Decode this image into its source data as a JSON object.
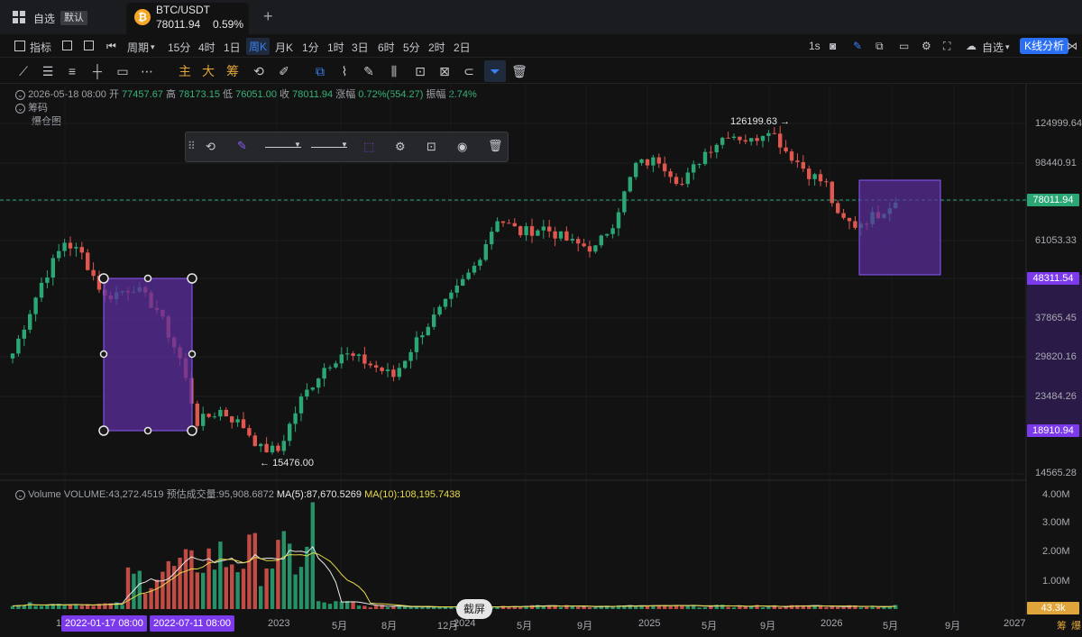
{
  "tabbar": {
    "watchlist": "自选",
    "default_badge": "默认",
    "pair": "BTC/USDT",
    "price": "78011.94",
    "change": "0.59%",
    "add": "+"
  },
  "toolbar": {
    "indicators": "指标",
    "period": "周期",
    "timeframes": [
      "15分",
      "4时",
      "1日",
      "周K",
      "月K",
      "1分",
      "1时",
      "3日",
      "6时",
      "5分",
      "2时",
      "2日"
    ],
    "active_timeframe": "周K",
    "interval_1s": "1s",
    "watch_label": "自选",
    "kline_analysis": "K线分析",
    "draw_text": {
      "main": "主",
      "big": "大",
      "chips": "筹"
    }
  },
  "ohlc": {
    "date": "2026-05-18 08:00",
    "open_label": "开",
    "open": "77457.67",
    "high_label": "高",
    "high": "78173.15",
    "low_label": "低",
    "low": "76051.00",
    "close_label": "收",
    "close": "78011.94",
    "chg_label": "涨幅",
    "chg": "0.72%(554.27)",
    "amp_label": "振幅",
    "amp": "2.74%"
  },
  "overlays": {
    "chips": "筹码",
    "liq": "爆仓图"
  },
  "chart_data": {
    "type": "candlestick",
    "symbol": "BTC/USDT",
    "interval": "weekly",
    "y_scale": "log",
    "ylim": [
      14000,
      150000
    ],
    "price_ticks": [
      "124999.64",
      "98440.91",
      "61053.33",
      "37865.45",
      "29820.16",
      "23484.26",
      "14565.28"
    ],
    "current_price": "78011.94",
    "range_labels": [
      "48311.54",
      "18910.94"
    ],
    "high_annotation": "126199.63",
    "low_annotation": "15476.00",
    "x_ticks": [
      "1",
      "2023",
      "5月",
      "8月",
      "12月",
      "2024",
      "5月",
      "9月",
      "2025",
      "5月",
      "9月",
      "2026",
      "5月",
      "9月",
      "2027"
    ],
    "x_selected": [
      "2022-01-17 08:00",
      "2022-07-11 08:00"
    ],
    "price_anchors": [
      {
        "t": 0,
        "p": 30500
      },
      {
        "t": 5,
        "p": 47000
      },
      {
        "t": 9,
        "p": 60500
      },
      {
        "t": 12,
        "p": 56000
      },
      {
        "t": 16,
        "p": 43000
      },
      {
        "t": 21,
        "p": 46000
      },
      {
        "t": 25,
        "p": 40000
      },
      {
        "t": 29,
        "p": 29500
      },
      {
        "t": 32,
        "p": 20000
      },
      {
        "t": 36,
        "p": 21500
      },
      {
        "t": 40,
        "p": 19500
      },
      {
        "t": 43,
        "p": 17000
      },
      {
        "t": 46,
        "p": 16800
      },
      {
        "t": 50,
        "p": 23000
      },
      {
        "t": 54,
        "p": 28000
      },
      {
        "t": 57,
        "p": 30500
      },
      {
        "t": 61,
        "p": 29000
      },
      {
        "t": 66,
        "p": 26500
      },
      {
        "t": 71,
        "p": 35000
      },
      {
        "t": 76,
        "p": 43000
      },
      {
        "t": 80,
        "p": 52000
      },
      {
        "t": 84,
        "p": 70000
      },
      {
        "t": 88,
        "p": 64000
      },
      {
        "t": 92,
        "p": 66000
      },
      {
        "t": 97,
        "p": 60000
      },
      {
        "t": 101,
        "p": 58000
      },
      {
        "t": 104,
        "p": 68000
      },
      {
        "t": 108,
        "p": 97000
      },
      {
        "t": 112,
        "p": 100000
      },
      {
        "t": 116,
        "p": 86000
      },
      {
        "t": 120,
        "p": 105000
      },
      {
        "t": 124,
        "p": 118000
      },
      {
        "t": 128,
        "p": 112000
      },
      {
        "t": 131,
        "p": 122000
      },
      {
        "t": 134,
        "p": 106000
      },
      {
        "t": 138,
        "p": 92000
      },
      {
        "t": 141,
        "p": 86000
      },
      {
        "t": 143,
        "p": 70000
      },
      {
        "t": 146,
        "p": 67000
      },
      {
        "t": 150,
        "p": 72000
      },
      {
        "t": 153,
        "p": 78000
      }
    ],
    "volume": {
      "label": "Volume",
      "value": "VOLUME:43,272.4519",
      "est_label": "预估成交量:95,908.6872",
      "ma5_label": "MA(5):87,670.5269",
      "ma10_label": "MA(10):108,195.7438",
      "ylim": [
        0,
        4500000
      ],
      "ticks": [
        "4.00M",
        "3.00M",
        "2.00M",
        "1.00M"
      ],
      "current": "43.3k",
      "colors": {
        "ma5": "#e8e8e8",
        "ma10": "#e6d84a"
      }
    },
    "screenshot_btn": "截屏",
    "bottom_right": [
      "筹",
      "爆"
    ],
    "colors": {
      "up": "#2aa775",
      "down": "#e0574f",
      "box": "#5b2d9e",
      "box_border": "#8b5cf6",
      "last_line": "#2aa775"
    }
  }
}
